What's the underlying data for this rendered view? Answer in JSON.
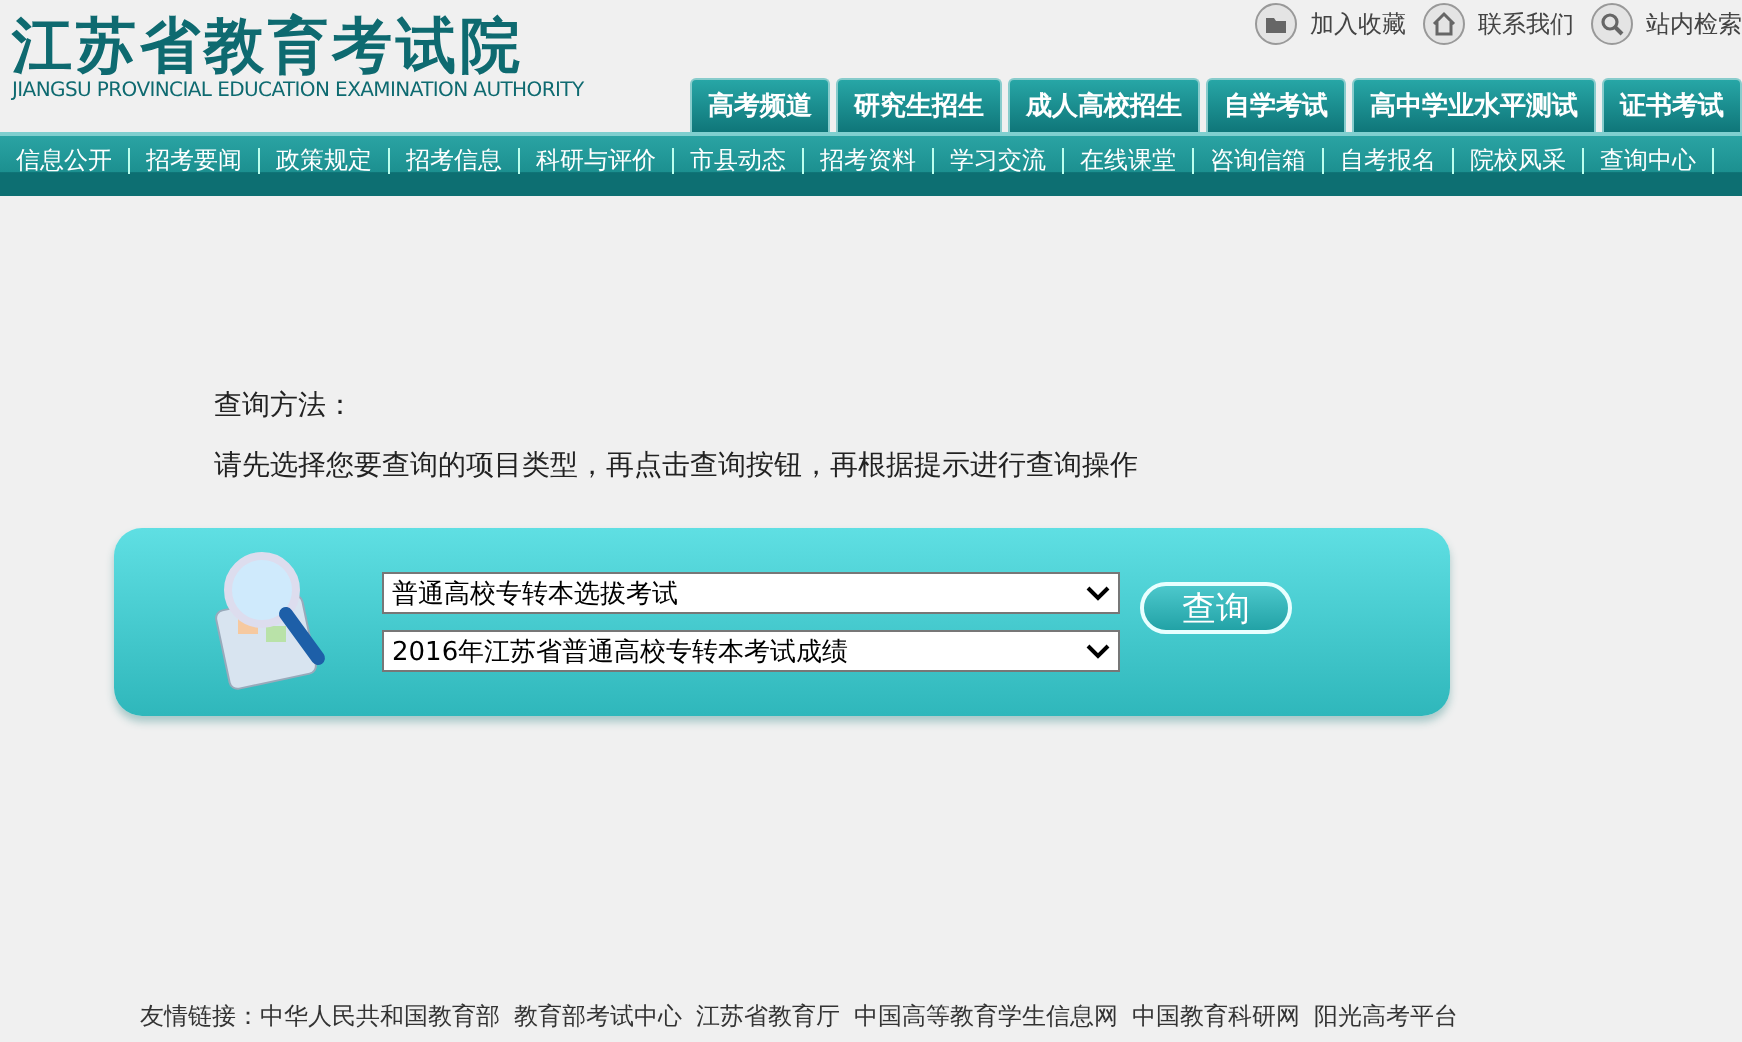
{
  "header": {
    "logo_title": "江苏省教育考试院",
    "logo_subtitle": "JIANGSU PROVINCIAL EDUCATION EXAMINATION AUTHORITY",
    "top_links": [
      {
        "label": "加入收藏",
        "kind": "folder"
      },
      {
        "label": "联系我们",
        "kind": "home"
      },
      {
        "label": "站内检索",
        "kind": "search"
      }
    ]
  },
  "channel_tabs": [
    "高考频道",
    "研究生招生",
    "成人高校招生",
    "自学考试",
    "高中学业水平测试",
    "证书考试"
  ],
  "nav_items": [
    "信息公开",
    "招考要闻",
    "政策规定",
    "招考信息",
    "科研与评价",
    "市县动态",
    "招考资料",
    "学习交流",
    "在线课堂",
    "咨询信箱",
    "自考报名",
    "院校风采",
    "查询中心"
  ],
  "instructions": {
    "heading": "查询方法：",
    "text": "请先选择您要查询的项目类型，再点击查询按钮，再根据提示进行查询操作"
  },
  "query": {
    "selects": [
      "普通高校专转本选拔考试",
      "2016年江苏省普通高校专转本考试成绩"
    ],
    "button": "查询"
  },
  "footer": {
    "label": "友情链接：",
    "links": [
      "中华人民共和国教育部",
      "教育部考试中心",
      "江苏省教育厅",
      "中国高等教育学生信息网",
      "中国教育科研网",
      "阳光高考平台"
    ]
  }
}
